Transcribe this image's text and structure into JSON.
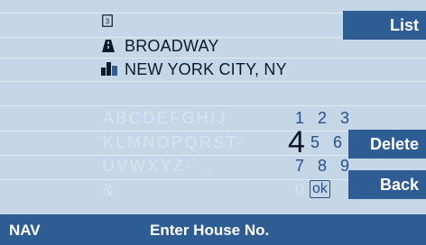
{
  "address": {
    "house_icon": "doc-square-icon",
    "house_icon_glyph": "3",
    "street_icon": "road-icon",
    "street": "BROADWAY",
    "city_icon": "city-skyline-icon",
    "city": "NEW YORK CITY, NY"
  },
  "side_buttons": {
    "list": "List",
    "delete": "Delete",
    "back": "Back"
  },
  "speller": {
    "row1_letters": "ABCDEFGHIJ",
    "row2_letters": "KLMNOPQRST-",
    "row3_letters": "UVWXYZ-`.,",
    "row4_letters": "&",
    "row1_digits": "1 2 3",
    "row2_selected": "4",
    "row2_digits": "5 6",
    "row3_digits": "7 8 9",
    "row4_digit": "0",
    "ok_label": "ok"
  },
  "status_bar": {
    "mode": "NAV",
    "prompt": "Enter House No."
  },
  "colors": {
    "background": "#c5d6e6",
    "accent": "#2e5d94",
    "digit_color": "#26508a"
  }
}
